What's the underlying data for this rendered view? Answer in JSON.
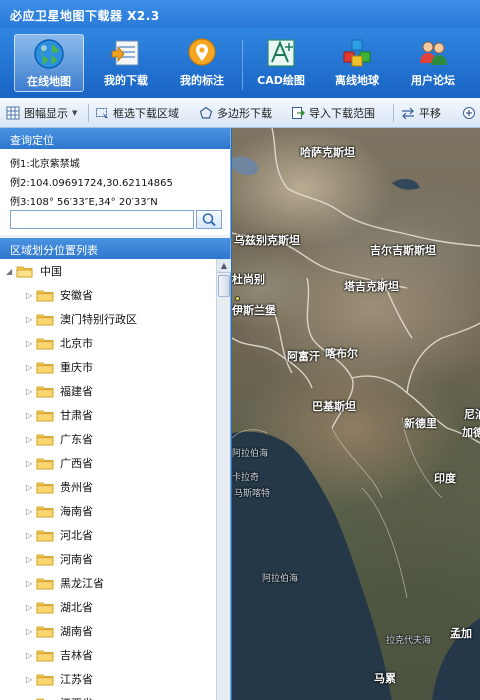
{
  "app": {
    "title": "必应卫星地图下载器 X2.3"
  },
  "main_toolbar": [
    {
      "label": "在线地图",
      "icon": "globe-icon",
      "active": true
    },
    {
      "label": "我的下载",
      "icon": "download-list-icon",
      "active": false
    },
    {
      "label": "我的标注",
      "icon": "location-pin-icon",
      "active": false
    },
    {
      "label": "CAD绘图",
      "icon": "cad-drawing-icon",
      "active": false
    },
    {
      "label": "离线地球",
      "icon": "offline-cubes-icon",
      "active": false
    },
    {
      "label": "用户论坛",
      "icon": "users-forum-icon",
      "active": false
    }
  ],
  "sub_toolbar": {
    "layer_label": "图幅显示",
    "rect_download_label": "框选下载区域",
    "polygon_download_label": "多边形下载",
    "import_label": "导入下载范围",
    "pan_label": "平移"
  },
  "query": {
    "header": "查询定位",
    "example1": "例1:北京紫禁城",
    "example2": "例2:104.09691724,30.62114865",
    "example3": "例3:108° 56′33″E,34° 20′33″N",
    "input_value": "",
    "input_placeholder": ""
  },
  "regions": {
    "header": "区域划分位置列表",
    "root": "中国",
    "items": [
      "安徽省",
      "澳门特别行政区",
      "北京市",
      "重庆市",
      "福建省",
      "甘肃省",
      "广东省",
      "广西省",
      "贵州省",
      "海南省",
      "河北省",
      "河南省",
      "黑龙江省",
      "湖北省",
      "湖南省",
      "吉林省",
      "江苏省",
      "江西省"
    ]
  },
  "map": {
    "labels": {
      "kazakhstan": "哈萨克斯坦",
      "uzbekistan": "乌兹别克斯坦",
      "kyrgyzstan": "吉尔吉斯斯坦",
      "tajikistan": "塔吉克斯坦",
      "dushanbe": "杜尚别",
      "kabul_region": "伊斯兰堡",
      "afghanistan": "阿富汗",
      "kabul": "喀布尔",
      "pakistan": "巴基斯坦",
      "new_delhi": "新德里",
      "nepal_partial": "尼泊",
      "kathmandu_partial": "加德",
      "arabian_sea": "阿拉伯海",
      "karachi": "卡拉奇",
      "muscat": "马斯喀特",
      "india": "印度",
      "ababo": "阿拉伯海",
      "sea_label": "阿拉伯海",
      "laccadive": "拉克代夫海",
      "malé": "马累",
      "bengal_partial": "孟加"
    }
  },
  "colors": {
    "titlebar": "#2a7ad8",
    "toolbar": "#1a64c3",
    "panel_header": "#2f77cf",
    "folder": "#f3c84b"
  }
}
